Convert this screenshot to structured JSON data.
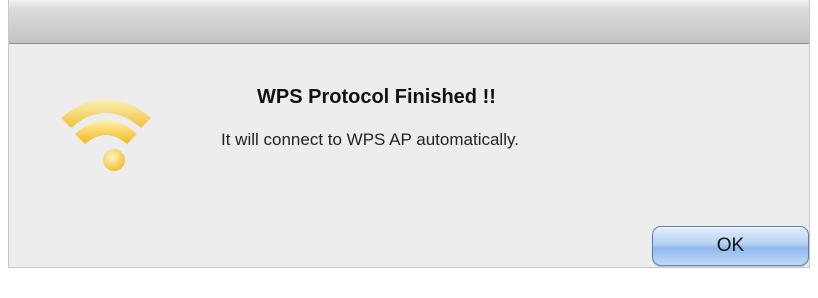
{
  "dialog": {
    "icon": "wifi-icon",
    "title": "WPS Protocol Finished !!",
    "message": "It will connect to WPS AP automatically.",
    "ok_label": "OK"
  },
  "colors": {
    "icon_yellow": "#f6c21a",
    "button_blue": "#9fc4f0"
  }
}
